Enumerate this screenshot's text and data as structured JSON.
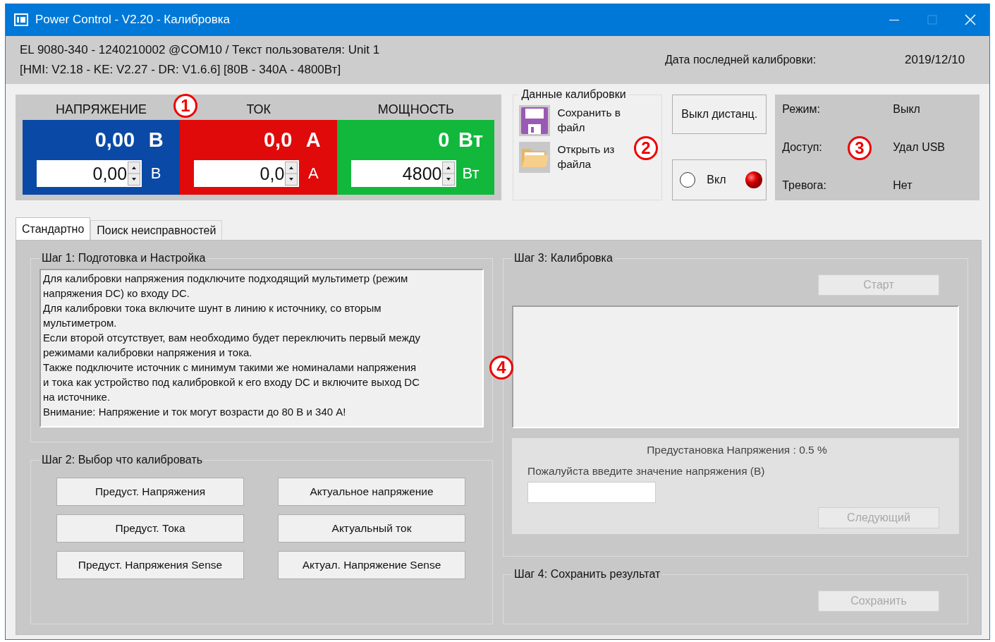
{
  "window": {
    "title": "Power Control - V2.20 - Калибровка"
  },
  "header": {
    "device_line": "EL 9080-340 - 1240210002 @COM10 / Текст пользователя: Unit 1",
    "firmware_line": "[HMI: V2.18 - KE: V2.27 - DR: V1.6.6] [80В - 340А - 4800Вт]",
    "last_calibration_label": "Дата последней калибровки:",
    "last_calibration_date": "2019/12/10"
  },
  "meters": [
    {
      "label": "НАПРЯЖЕНИЕ",
      "value": "0,00",
      "unit": "В",
      "setpoint": "0,00",
      "setpoint_unit": "В",
      "color": "#0a4aa6"
    },
    {
      "label": "ТОК",
      "value": "0,0",
      "unit": "А",
      "setpoint": "0,0",
      "setpoint_unit": "А",
      "color": "#e10a0a"
    },
    {
      "label": "МОЩНОСТЬ",
      "value": "0",
      "unit": "Вт",
      "setpoint": "4800",
      "setpoint_unit": "Вт",
      "color": "#12b83c"
    }
  ],
  "calibration_data": {
    "title": "Данные калибровки",
    "actions": [
      {
        "kind": "save",
        "label": "Сохранить в файл"
      },
      {
        "kind": "open",
        "label": "Открыть из файла"
      }
    ]
  },
  "remote_button": {
    "label": "Выкл дистанц."
  },
  "output_toggle": {
    "label": "Вкл",
    "checked": false
  },
  "status": [
    {
      "label": "Режим:",
      "value": "Выкл"
    },
    {
      "label": "Доступ:",
      "value": "Удал USB"
    },
    {
      "label": "Тревога:",
      "value": "Нет"
    }
  ],
  "tabs": [
    {
      "label": "Стандартно",
      "selected": true
    },
    {
      "label": "Поиск неисправностей",
      "selected": false
    }
  ],
  "step1": {
    "title": "Шаг 1: Подготовка и Настройка",
    "instructions": "Для калибровки напряжения подключите подходящий мультиметр (режим\nнапряжения DC) ко входу DC.\nДля калибровки тока включите шунт в линию к источнику, со вторым\nмультиметром.\nЕсли второй отсутствует, вам необходимо будет переключить первый между\nрежимами калибровки напряжения и тока.\nТакже подключите источник с минимум такими же номиналами напряжения\nи тока как устройство под калибровкой к его входу DC и включите выход DC\nна источнике.\nВнимание: Напряжение и ток могут возрасти до 80 В и 340 А!"
  },
  "step2": {
    "title": "Шаг 2: Выбор что калибровать",
    "buttons": [
      "Предуст. Напряжения",
      "Актуальное напряжение",
      "Предуст. Тока",
      "Актуальный ток",
      "Предуст. Напряжения Sense",
      "Актуал. Напряжение Sense"
    ]
  },
  "step3": {
    "title": "Шаг 3: Калибровка",
    "start_button": {
      "label": "Старт",
      "disabled": true
    },
    "preset_label": "Предустановка Напряжения : 0.5 %",
    "prompt": "Пожалуйста введите значение напряжения (В)",
    "next_button": {
      "label": "Следующий",
      "disabled": true
    }
  },
  "step4": {
    "title": "Шаг 4: Сохранить результат",
    "save_button": {
      "label": "Сохранить",
      "disabled": true
    }
  },
  "callouts": [
    "1",
    "2",
    "3",
    "4"
  ]
}
